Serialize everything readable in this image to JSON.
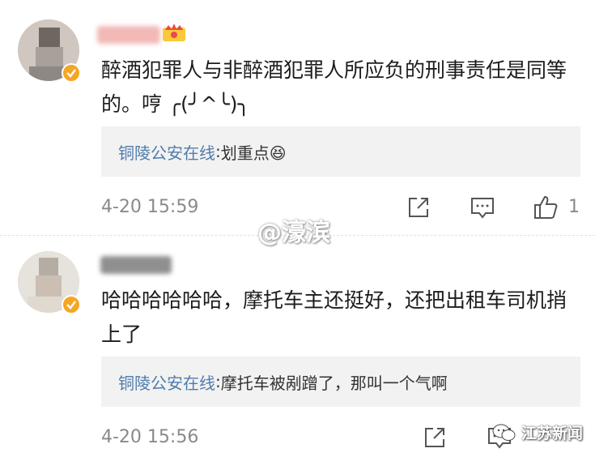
{
  "comments": [
    {
      "text": "醉酒犯罪人与非醉酒犯罪人所应负的刑事责任是同等的。哼 ╭(╯^╰)╮",
      "reply_author": "铜陵公安在线",
      "reply_sep": ": ",
      "reply_text": "划重点😆",
      "time": "4-20 15:59",
      "likes": "1"
    },
    {
      "text": "哈哈哈哈哈哈，摩托车主还挺好，还把出租车司机捎上了",
      "reply_author": "铜陵公安在线",
      "reply_sep": ": ",
      "reply_text": "摩托车被剐蹭了，那叫一个气啊",
      "time": "4-20 15:56"
    }
  ],
  "watermark": "@濠滨",
  "source_logo": "江苏新闻",
  "colors": {
    "reply_author": "#4f7cae",
    "verified_badge": "#f5a623",
    "reply_bg": "#f2f2f2"
  },
  "icons": [
    "share-icon",
    "comment-icon",
    "like-icon",
    "crown-badge-icon",
    "verified-badge-icon",
    "wechat-icon"
  ]
}
